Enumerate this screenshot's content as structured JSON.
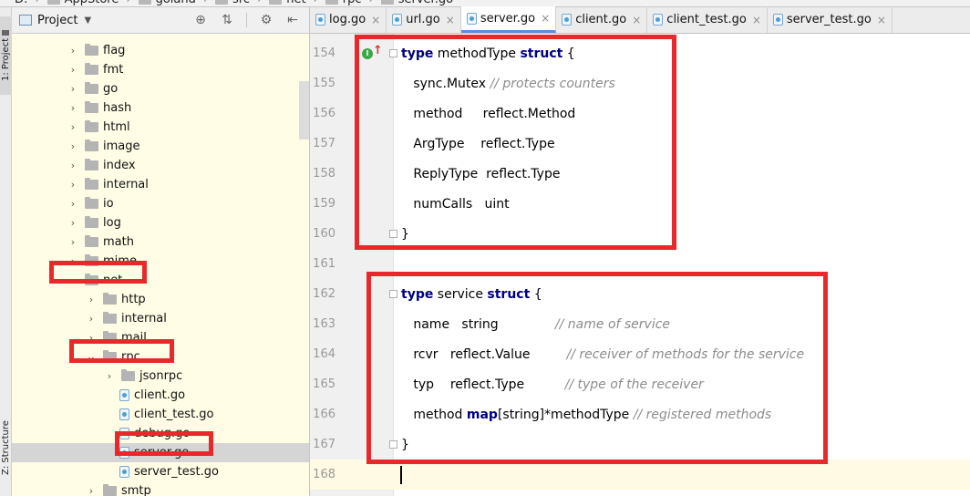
{
  "breadcrumb": [
    {
      "label": "D:"
    },
    {
      "label": "AppStore"
    },
    {
      "label": "goland"
    },
    {
      "label": "src"
    },
    {
      "label": "net"
    },
    {
      "label": "rpc"
    },
    {
      "label": "server.go"
    }
  ],
  "toolwindows": {
    "project_tab": "1: Project",
    "structure_tab": "Z: Structure"
  },
  "project_panel": {
    "title": "Project",
    "tree": [
      {
        "label": "flag",
        "type": "folder",
        "depth": 0,
        "expanded": false
      },
      {
        "label": "fmt",
        "type": "folder",
        "depth": 0,
        "expanded": false
      },
      {
        "label": "go",
        "type": "folder",
        "depth": 0,
        "expanded": false
      },
      {
        "label": "hash",
        "type": "folder",
        "depth": 0,
        "expanded": false
      },
      {
        "label": "html",
        "type": "folder",
        "depth": 0,
        "expanded": false
      },
      {
        "label": "image",
        "type": "folder",
        "depth": 0,
        "expanded": false
      },
      {
        "label": "index",
        "type": "folder",
        "depth": 0,
        "expanded": false
      },
      {
        "label": "internal",
        "type": "folder",
        "depth": 0,
        "expanded": false
      },
      {
        "label": "io",
        "type": "folder",
        "depth": 0,
        "expanded": false
      },
      {
        "label": "log",
        "type": "folder",
        "depth": 0,
        "expanded": false
      },
      {
        "label": "math",
        "type": "folder",
        "depth": 0,
        "expanded": false
      },
      {
        "label": "mime",
        "type": "folder",
        "depth": 0,
        "expanded": false
      },
      {
        "label": "net",
        "type": "folder",
        "depth": 0,
        "expanded": true
      },
      {
        "label": "http",
        "type": "folder",
        "depth": 1,
        "expanded": false
      },
      {
        "label": "internal",
        "type": "folder",
        "depth": 1,
        "expanded": false
      },
      {
        "label": "mail",
        "type": "folder",
        "depth": 1,
        "expanded": false
      },
      {
        "label": "rpc",
        "type": "folder",
        "depth": 1,
        "expanded": true
      },
      {
        "label": "jsonrpc",
        "type": "folder",
        "depth": 2,
        "expanded": false
      },
      {
        "label": "client.go",
        "type": "file",
        "depth": 2
      },
      {
        "label": "client_test.go",
        "type": "file",
        "depth": 2
      },
      {
        "label": "debug.go",
        "type": "file",
        "depth": 2
      },
      {
        "label": "server.go",
        "type": "file",
        "depth": 2,
        "selected": true
      },
      {
        "label": "server_test.go",
        "type": "file",
        "depth": 2
      },
      {
        "label": "smtp",
        "type": "folder",
        "depth": 1,
        "expanded": false
      }
    ]
  },
  "tabs": [
    {
      "label": "log.go",
      "active": false
    },
    {
      "label": "url.go",
      "active": false
    },
    {
      "label": "server.go",
      "active": true
    },
    {
      "label": "client.go",
      "active": false
    },
    {
      "label": "client_test.go",
      "active": false
    },
    {
      "label": "server_test.go",
      "active": false
    }
  ],
  "editor": {
    "current_line": "168",
    "lines": [
      {
        "num": "154",
        "parts": [
          [
            "type",
            "kw"
          ],
          [
            " methodType ",
            ""
          ],
          [
            "struct",
            "kw"
          ],
          [
            " {",
            ""
          ]
        ]
      },
      {
        "num": "155",
        "parts": [
          [
            "   sync.Mutex ",
            ""
          ],
          [
            "// protects counters",
            "cm"
          ]
        ]
      },
      {
        "num": "156",
        "parts": [
          [
            "   method     reflect.Method",
            ""
          ]
        ]
      },
      {
        "num": "157",
        "parts": [
          [
            "   ArgType    reflect.Type",
            ""
          ]
        ]
      },
      {
        "num": "158",
        "parts": [
          [
            "   ReplyType  reflect.Type",
            ""
          ]
        ]
      },
      {
        "num": "159",
        "parts": [
          [
            "   numCalls   uint",
            ""
          ]
        ]
      },
      {
        "num": "160",
        "parts": [
          [
            "}",
            ""
          ]
        ]
      },
      {
        "num": "161",
        "parts": []
      },
      {
        "num": "162",
        "parts": [
          [
            "type",
            "kw"
          ],
          [
            " service ",
            ""
          ],
          [
            "struct",
            "kw"
          ],
          [
            " {",
            ""
          ]
        ]
      },
      {
        "num": "163",
        "parts": [
          [
            "   name   string              ",
            ""
          ],
          [
            "// name of service",
            "cm"
          ]
        ]
      },
      {
        "num": "164",
        "parts": [
          [
            "   rcvr   reflect.Value         ",
            ""
          ],
          [
            "// receiver of methods for the service",
            "cm"
          ]
        ]
      },
      {
        "num": "165",
        "parts": [
          [
            "   typ    reflect.Type          ",
            ""
          ],
          [
            "// type of the receiver",
            "cm"
          ]
        ]
      },
      {
        "num": "166",
        "parts": [
          [
            "   method ",
            ""
          ],
          [
            "map",
            "kw"
          ],
          [
            "[string]*methodType ",
            ""
          ],
          [
            "// registered methods",
            "cm"
          ]
        ]
      },
      {
        "num": "167",
        "parts": [
          [
            "}",
            ""
          ]
        ]
      },
      {
        "num": "168",
        "parts": []
      }
    ]
  },
  "colors": {
    "annotation_red": "#e8282a",
    "keyword": "#000080",
    "comment": "#8c8c8c",
    "panel_bg": "#fffde6"
  }
}
